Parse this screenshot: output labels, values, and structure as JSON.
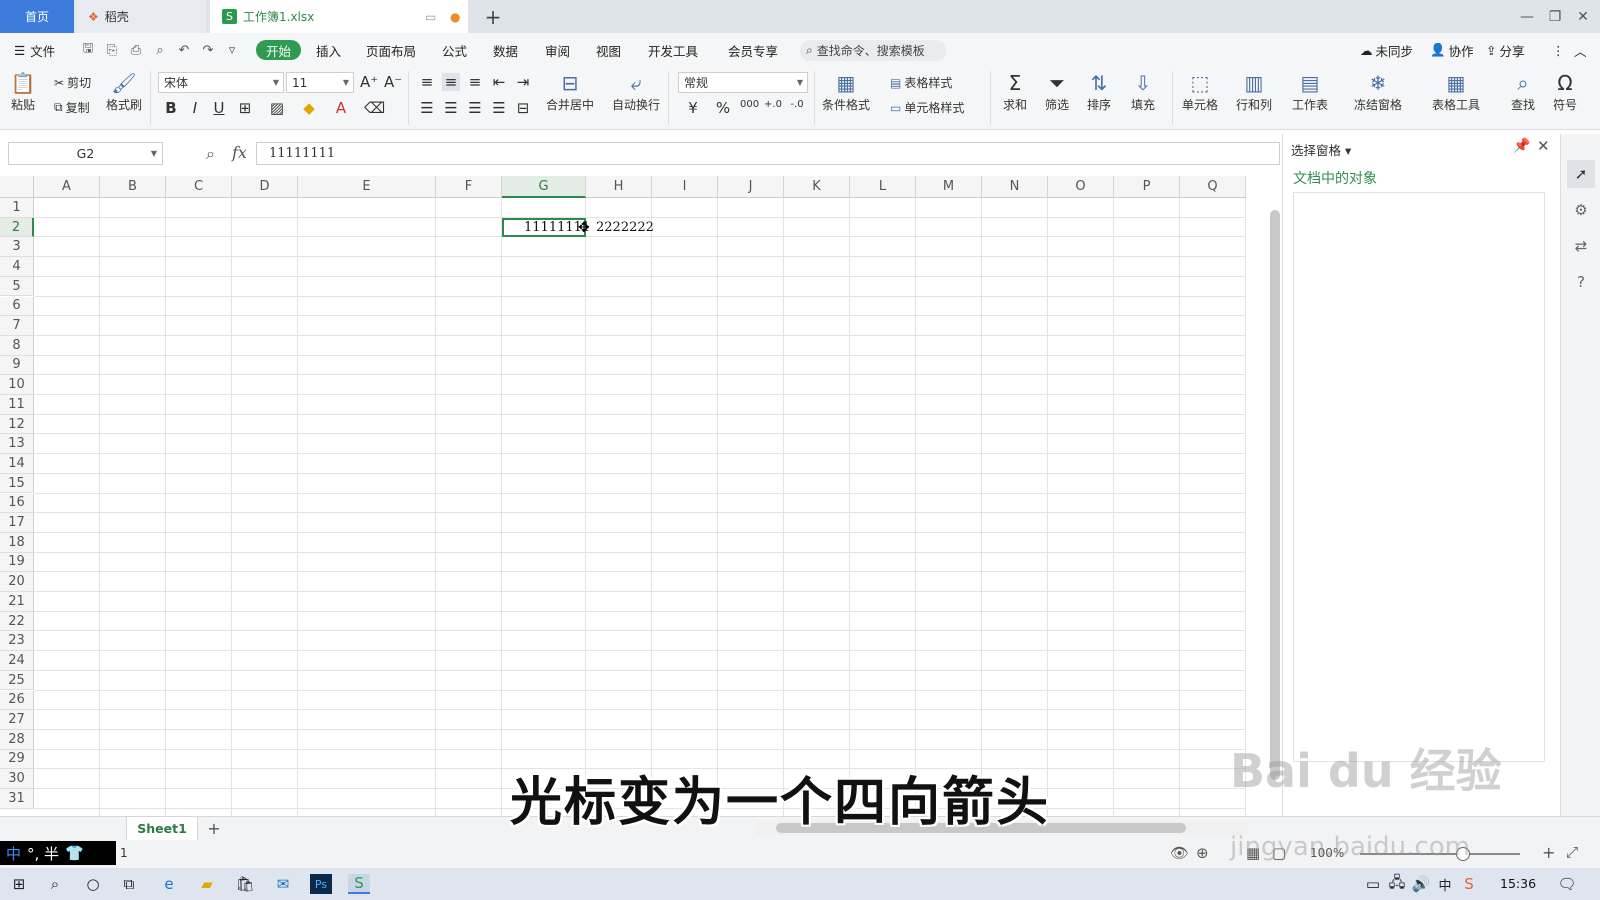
{
  "tabs": {
    "home": "首页",
    "daoke": "稻壳",
    "workbook": "工作簿1.xlsx",
    "add": "+"
  },
  "menu": {
    "file": "文件",
    "items": [
      "开始",
      "插入",
      "页面布局",
      "公式",
      "数据",
      "审阅",
      "视图",
      "开发工具",
      "会员专享"
    ],
    "search": "查找命令、搜索模板",
    "unsynced": "未同步",
    "collab": "协作",
    "share": "分享"
  },
  "ribbon": {
    "paste": "粘贴",
    "cut": "剪切",
    "copy": "复制",
    "format_painter": "格式刷",
    "font_name": "宋体",
    "font_size": "11",
    "merge_center": "合并居中",
    "wrap": "自动换行",
    "number_format": "常规",
    "cond_format": "条件格式",
    "table_style": "表格样式",
    "cell_style": "单元格样式",
    "sum": "求和",
    "filter": "筛选",
    "sort": "排序",
    "fill": "填充",
    "cell": "单元格",
    "row_col": "行和列",
    "worksheet": "工作表",
    "freeze": "冻结窗格",
    "table_tools": "表格工具",
    "find": "查找",
    "symbol": "符号"
  },
  "formula_bar": {
    "name_box": "G2",
    "fx": "fx",
    "content": "11111111"
  },
  "grid": {
    "columns": [
      "A",
      "B",
      "C",
      "D",
      "E",
      "F",
      "G",
      "H",
      "I",
      "J",
      "K",
      "L",
      "M",
      "N",
      "O",
      "P",
      "Q"
    ],
    "selected_column": "G",
    "rows": [
      "1",
      "2",
      "3",
      "4",
      "5",
      "6",
      "7",
      "8",
      "9",
      "10",
      "11",
      "12",
      "13",
      "14",
      "15",
      "16",
      "17",
      "18",
      "19",
      "20",
      "21",
      "22",
      "23",
      "24",
      "25",
      "26",
      "27",
      "28",
      "29",
      "30",
      "31"
    ],
    "selected_row": "2",
    "cells": {
      "G2": "11111111",
      "H2": "2222222"
    }
  },
  "panel": {
    "title": "选择窗格",
    "subtitle": "文档中的对象"
  },
  "sheets": {
    "active": "Sheet1",
    "add": "+"
  },
  "status": {
    "page": "1",
    "zoom": "100%",
    "ime": "中",
    "ime_extra": "°, 半"
  },
  "taskbar": {
    "time": "15:36"
  },
  "caption": "光标变为一个四向箭头",
  "watermark": "Bai du 经验",
  "watermark_url": "jingyan.baidu.com"
}
